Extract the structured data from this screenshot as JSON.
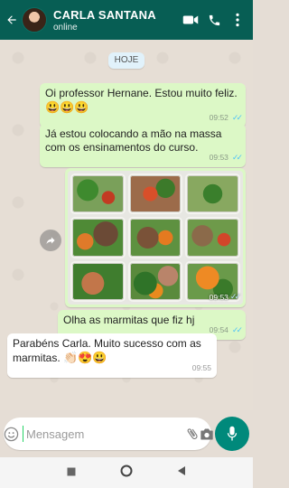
{
  "header": {
    "contact_name": "CARLA SANTANA",
    "status": "online",
    "icons": [
      "back-arrow-icon",
      "video-call-icon",
      "phone-icon",
      "more-vertical-icon"
    ],
    "color": "#075e54"
  },
  "chat": {
    "date_label": "HOJE",
    "messages": [
      {
        "direction": "out",
        "text": "Oi professor Hernane. Estou muito feliz.",
        "emoji": "😃😃😃",
        "time": "09:52",
        "status": "read"
      },
      {
        "direction": "out",
        "text": "Já estou colocando a mão na massa com os ensinamentos do curso.",
        "time": "09:53",
        "status": "read"
      },
      {
        "direction": "out",
        "type": "image",
        "time": "09:53",
        "status": "read"
      },
      {
        "direction": "out",
        "text": "Olha as marmitas que fiz hj",
        "time": "09:54",
        "status": "read"
      },
      {
        "direction": "in",
        "text": "Parabéns Carla. Muito sucesso com as marmitas.",
        "emoji": "👏🏻😍😃",
        "time": "09:55"
      }
    ]
  },
  "input": {
    "placeholder": "Mensagem",
    "value": ""
  },
  "colors": {
    "outgoing_bubble": "#dcf8c6",
    "incoming_bubble": "#ffffff",
    "read_ticks": "#4fc3f7",
    "mic_button": "#00897b"
  }
}
